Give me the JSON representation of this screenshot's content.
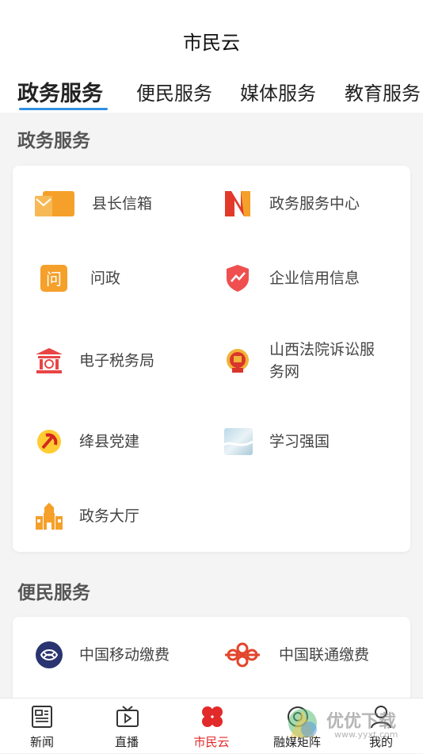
{
  "header": {
    "title": "市民云"
  },
  "tabs": [
    {
      "label": "政务服务",
      "active": true
    },
    {
      "label": "便民服务",
      "active": false
    },
    {
      "label": "媒体服务",
      "active": false
    },
    {
      "label": "教育服务",
      "active": false
    }
  ],
  "sections": [
    {
      "title": "政务服务",
      "items": [
        {
          "label": "县长信箱",
          "icon": "mailbox-icon"
        },
        {
          "label": "政务服务中心",
          "icon": "service-center-logo-icon"
        },
        {
          "label": "问政",
          "icon": "ask-icon"
        },
        {
          "label": "企业信用信息",
          "icon": "credit-shield-icon"
        },
        {
          "label": "电子税务局",
          "icon": "tax-bureau-icon"
        },
        {
          "label": "山西法院诉讼服务网",
          "icon": "court-emblem-icon"
        },
        {
          "label": "绛县党建",
          "icon": "party-emblem-icon"
        },
        {
          "label": "学习强国",
          "icon": "xuexi-qiangguo-icon"
        },
        {
          "label": "政务大厅",
          "icon": "government-hall-icon"
        }
      ]
    },
    {
      "title": "便民服务",
      "items": [
        {
          "label": "中国移动缴费",
          "icon": "china-mobile-icon"
        },
        {
          "label": "中国联通缴费",
          "icon": "china-unicom-icon"
        }
      ]
    }
  ],
  "bottom_nav": [
    {
      "label": "新闻",
      "icon": "news-icon",
      "active": false
    },
    {
      "label": "直播",
      "icon": "tv-live-icon",
      "active": false
    },
    {
      "label": "市民云",
      "icon": "citizen-cloud-icon",
      "active": true
    },
    {
      "label": "融媒矩阵",
      "icon": "media-matrix-icon",
      "active": false
    },
    {
      "label": "我的",
      "icon": "profile-icon",
      "active": false
    }
  ],
  "watermark": {
    "text": "优优下载",
    "sub": "www.yyxt.com"
  },
  "colors": {
    "accent_blue": "#2f8fe2",
    "active_red": "#e22a2a",
    "orange": "#f5a02a"
  }
}
